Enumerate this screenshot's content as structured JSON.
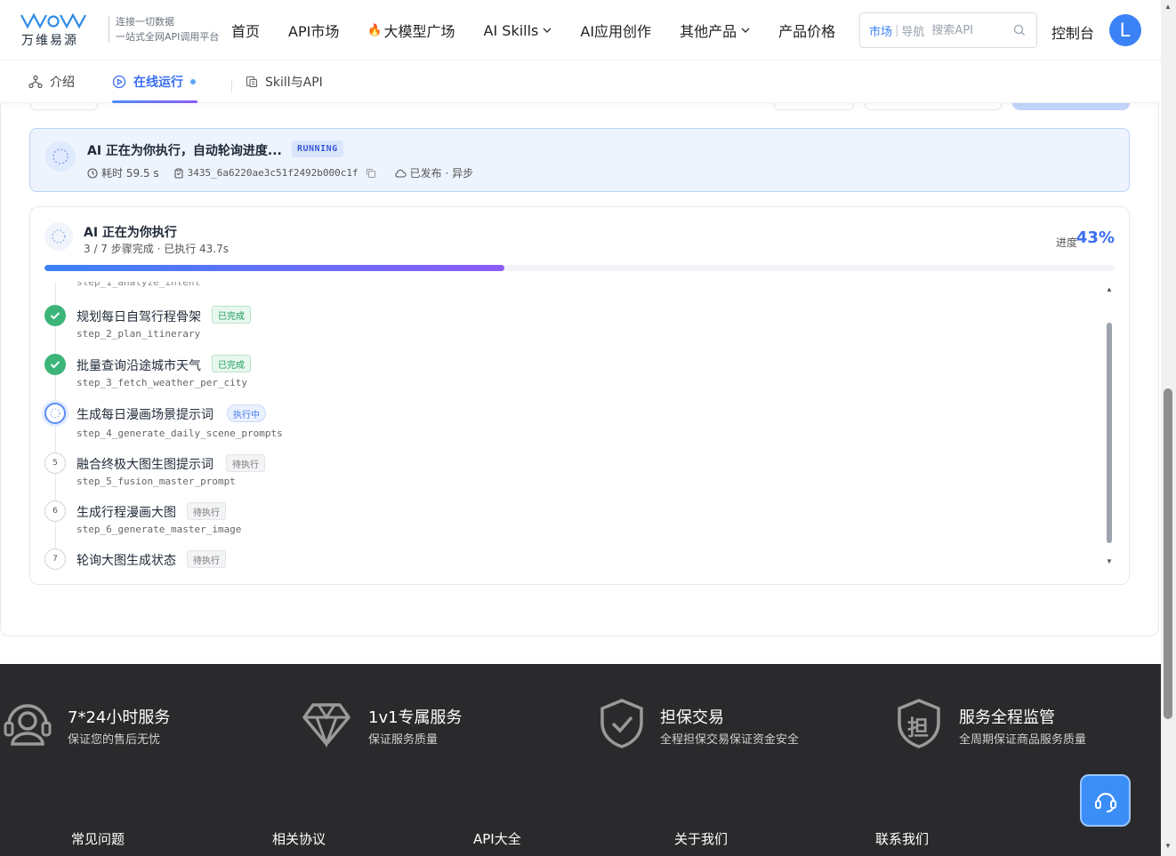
{
  "logo": {
    "name": "万维易源",
    "slogan_line1": "连接一切数据",
    "slogan_line2": "一站式全网API调用平台"
  },
  "nav": {
    "items": [
      {
        "label": "首页"
      },
      {
        "label": "API市场"
      },
      {
        "label": "大模型广场"
      },
      {
        "label": "AI Skills"
      },
      {
        "label": "AI应用创作"
      },
      {
        "label": "其他产品"
      },
      {
        "label": "产品价格"
      }
    ]
  },
  "search": {
    "market_label": "市场",
    "nav_label": "导航",
    "placeholder": "搜索API"
  },
  "header": {
    "console_label": "控制台",
    "avatar_letter": "L"
  },
  "tabs": [
    {
      "label": "介绍"
    },
    {
      "label": "在线运行"
    },
    {
      "label": "Skill与API"
    }
  ],
  "banner": {
    "title": "AI 正在为你执行，自动轮询进度...",
    "status": "RUNNING",
    "elapsed": "耗时 59.5 s",
    "task_id": "3435_6a6220ae3c51f2492b000c1f",
    "publish": "已发布 · 异步"
  },
  "progress": {
    "title": "AI 正在为你执行",
    "subtitle": "3 / 7 步骤完成 · 已执行 43.7s",
    "label": "进度",
    "value_text": "43%",
    "fraction": 0.43
  },
  "steps": [
    {
      "name": "规划每日自驾行程骨架",
      "id": "step_2_plan_itinerary",
      "status": "已完成",
      "state": "done"
    },
    {
      "name": "批量查询沿途城市天气",
      "id": "step_3_fetch_weather_per_city",
      "status": "已完成",
      "state": "done"
    },
    {
      "name": "生成每日漫画场景提示词",
      "id": "step_4_generate_daily_scene_prompts",
      "status": "执行中",
      "state": "running"
    },
    {
      "name": "融合终极大图生图提示词",
      "id": "step_5_fusion_master_prompt",
      "status": "待执行",
      "state": "pending",
      "num": "5"
    },
    {
      "name": "生成行程漫画大图",
      "id": "step_6_generate_master_image",
      "status": "待执行",
      "state": "pending",
      "num": "6"
    },
    {
      "name": "轮询大图生成状态",
      "id": "",
      "status": "待执行",
      "state": "pending",
      "num": "7"
    }
  ],
  "footer": {
    "features": [
      {
        "title": "7*24小时服务",
        "desc": "保证您的售后无忧"
      },
      {
        "title": "1v1专属服务",
        "desc": "保证服务质量"
      },
      {
        "title": "担保交易",
        "desc": "全程担保交易保证资金安全"
      },
      {
        "title": "服务全程监管",
        "desc": "全周期保证商品服务质量"
      }
    ],
    "links": [
      {
        "label": "常见问题"
      },
      {
        "label": "相关协议"
      },
      {
        "label": "API大全"
      },
      {
        "label": "关于我们"
      },
      {
        "label": "联系我们"
      }
    ],
    "guarantee_glyph": "担"
  },
  "colors": {
    "primary": "#3b82f6",
    "success": "#3bb57a",
    "footer_bg": "#2a2a2c"
  }
}
